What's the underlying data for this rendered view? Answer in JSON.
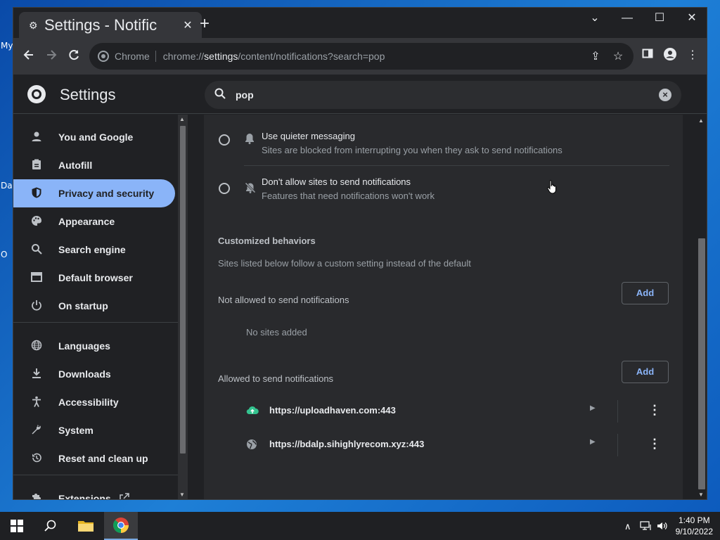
{
  "desktop": {
    "fragments": [
      "My",
      "Da",
      "O"
    ]
  },
  "browser": {
    "tab_title": "Settings - Notific",
    "tab_close": "✕",
    "new_tab": "+",
    "omnibox_chip": "Chrome",
    "url_scheme": "chrome://",
    "url_host": "settings",
    "url_path": "/content/notifications?search=pop",
    "window_controls": [
      "⌄",
      "—",
      "☐",
      "✕"
    ]
  },
  "settings": {
    "title": "Settings",
    "search_query": "pop",
    "nav": [
      {
        "label": "You and Google",
        "icon": "person-icon"
      },
      {
        "label": "Autofill",
        "icon": "clipboard-icon"
      },
      {
        "label": "Privacy and security",
        "icon": "shield-icon",
        "active": true
      },
      {
        "label": "Appearance",
        "icon": "palette-icon"
      },
      {
        "label": "Search engine",
        "icon": "search-icon"
      },
      {
        "label": "Default browser",
        "icon": "browser-icon"
      },
      {
        "label": "On startup",
        "icon": "power-icon"
      },
      {
        "label": "Languages",
        "icon": "globe-icon"
      },
      {
        "label": "Downloads",
        "icon": "download-icon"
      },
      {
        "label": "Accessibility",
        "icon": "accessibility-icon"
      },
      {
        "label": "System",
        "icon": "wrench-icon"
      },
      {
        "label": "Reset and clean up",
        "icon": "history-icon"
      },
      {
        "label": "Extensions",
        "icon": "puzzle-icon"
      }
    ],
    "options": [
      {
        "title": "Use quieter messaging",
        "subtitle": "Sites are blocked from interrupting you when they ask to send notifications"
      },
      {
        "title": "Don't allow sites to send notifications",
        "subtitle": "Features that need notifications won't work"
      }
    ],
    "customized": {
      "title": "Customized behaviors",
      "description": "Sites listed below follow a custom setting instead of the default",
      "not_allowed_label": "Not allowed to send notifications",
      "add_label": "Add",
      "no_sites": "No sites added",
      "allowed_label": "Allowed to send notifications",
      "allowed_sites": [
        {
          "url": "https://uploadhaven.com:443"
        },
        {
          "url": "https://bdalp.sihighlyrecom.xyz:443"
        }
      ]
    }
  },
  "taskbar": {
    "time": "1:40 PM",
    "date": "9/10/2022"
  }
}
